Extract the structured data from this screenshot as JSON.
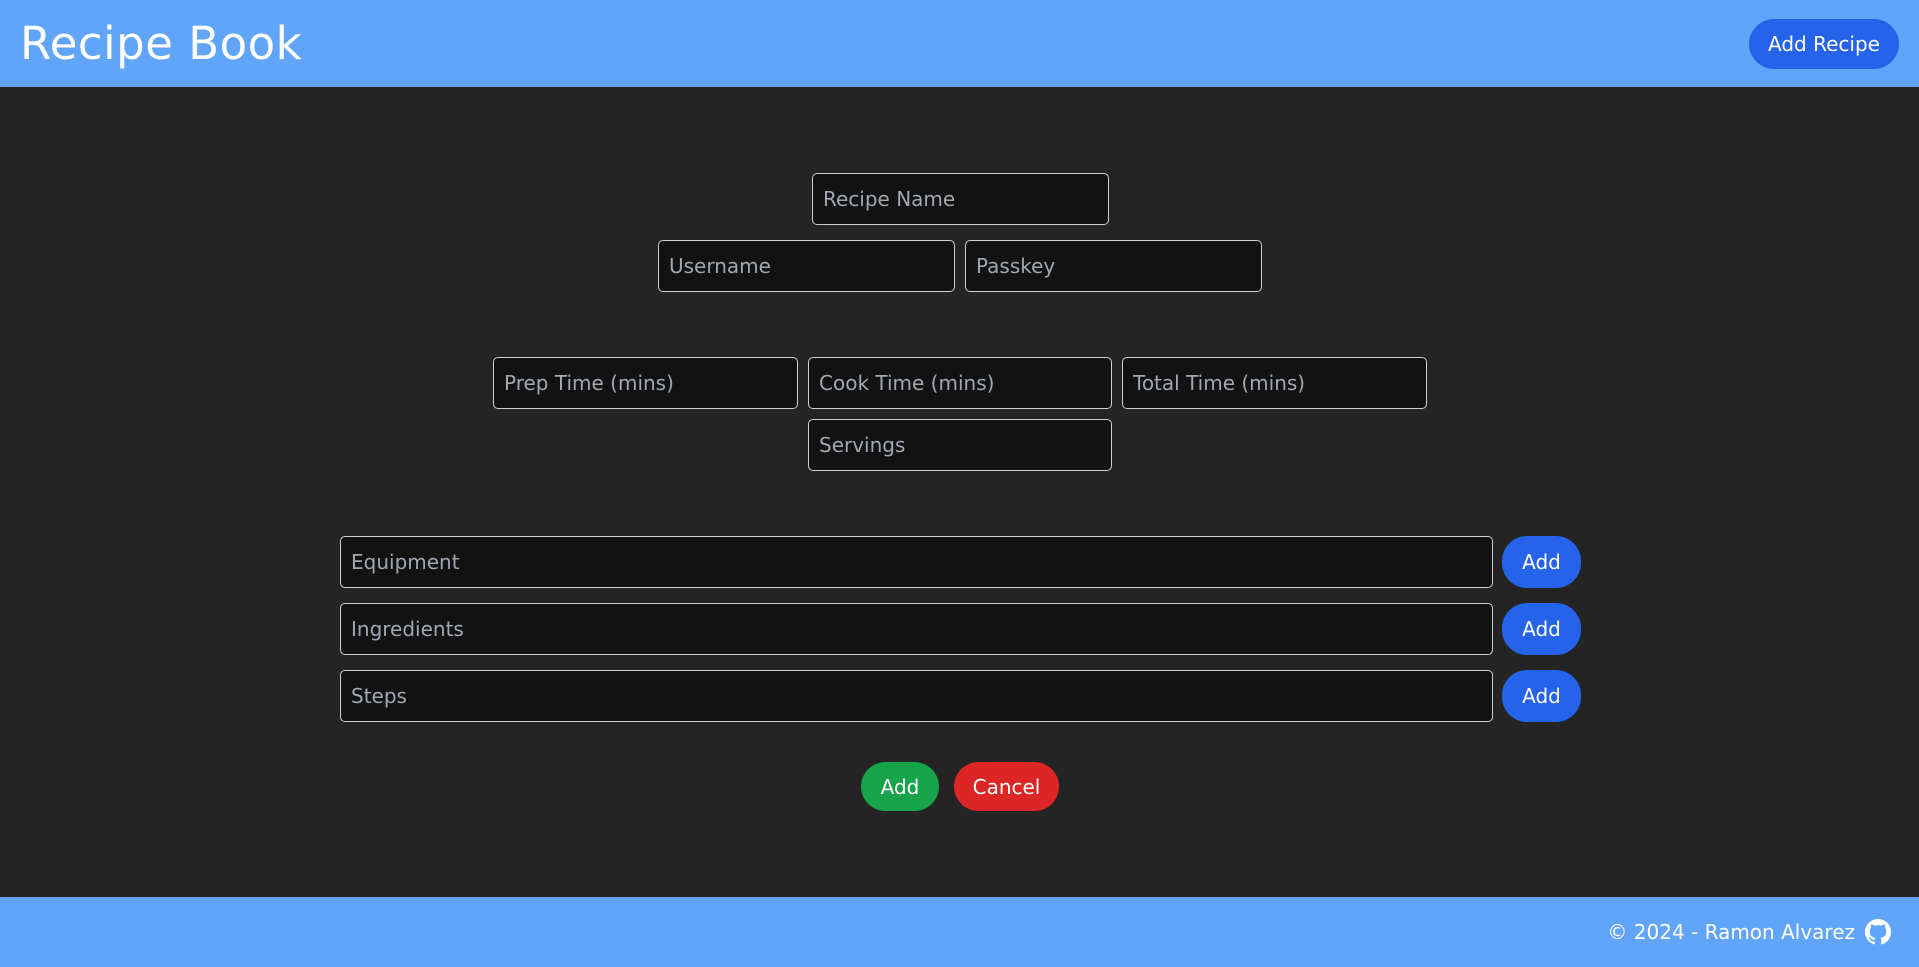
{
  "header": {
    "title": "Recipe Book",
    "add_recipe_label": "Add Recipe"
  },
  "form": {
    "recipe_name_placeholder": "Recipe Name",
    "username_placeholder": "Username",
    "passkey_placeholder": "Passkey",
    "prep_time_placeholder": "Prep Time (mins)",
    "cook_time_placeholder": "Cook Time (mins)",
    "total_time_placeholder": "Total Time (mins)",
    "servings_placeholder": "Servings",
    "equipment_placeholder": "Equipment",
    "ingredients_placeholder": "Ingredients",
    "steps_placeholder": "Steps",
    "add_item_label": "Add",
    "submit_label": "Add",
    "cancel_label": "Cancel"
  },
  "footer": {
    "copyright": "© 2024 - Ramon Alvarez",
    "github_icon": "github-icon"
  },
  "colors": {
    "header_bg": "#60a5fa",
    "page_bg": "#242424",
    "primary": "#2563eb",
    "success": "#16a34a",
    "danger": "#dc2626"
  }
}
